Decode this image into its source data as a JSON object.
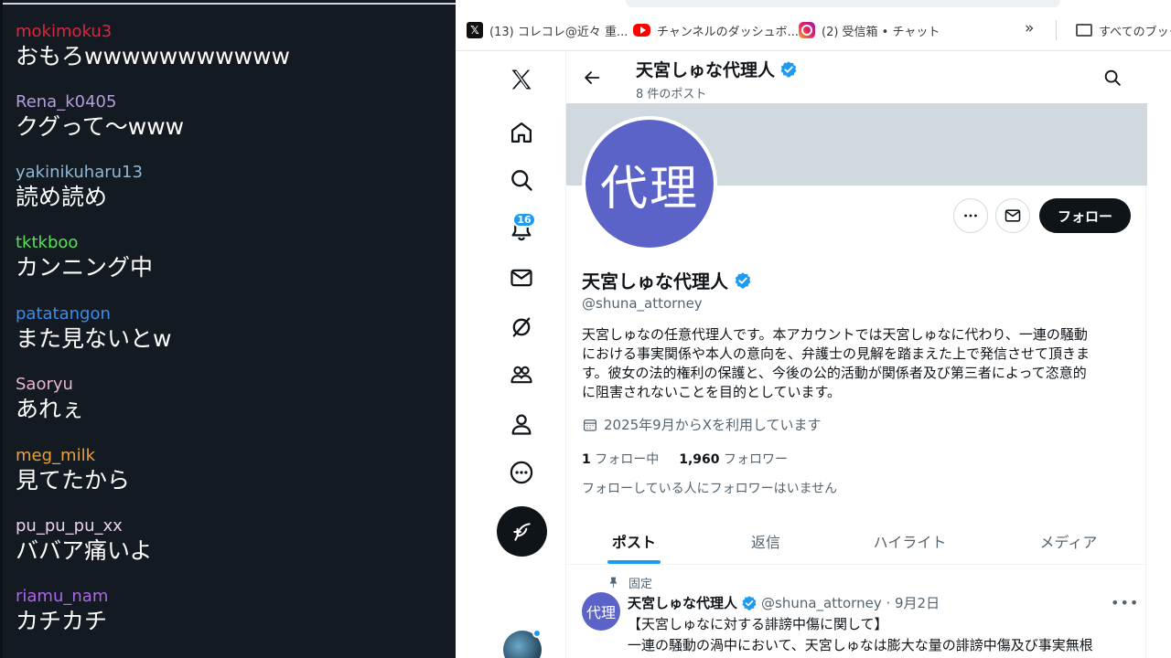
{
  "chat": {
    "messages": [
      {
        "user": "mokimoku3",
        "text": "おもろwwwwwwwwwww",
        "color": "#e0243c"
      },
      {
        "user": "Rena_k0405",
        "text": "クグって～www",
        "color": "#b39ddb"
      },
      {
        "user": "yakinikuharu13",
        "text": "読め読め",
        "color": "#8fb8d8"
      },
      {
        "user": "tktkboo",
        "text": "カンニング中",
        "color": "#58e05a"
      },
      {
        "user": "patatangon",
        "text": "また見ないとw",
        "color": "#3f8be8"
      },
      {
        "user": "Saoryu",
        "text": "あれぇ",
        "color": "#e8b7c9"
      },
      {
        "user": "meg_milk",
        "text": "見てたから",
        "color": "#e8a23a"
      },
      {
        "user": "pu_pu_pu_xx",
        "text": "ババア痛いよ",
        "color": "#ead1f0"
      },
      {
        "user": "riamu_nam",
        "text": "カチカチ",
        "color": "#b066e8"
      }
    ]
  },
  "bookmarks": {
    "items": [
      {
        "label": "(13) コレコレ@近々 重...",
        "icon": "x-icon"
      },
      {
        "label": "チャンネルのダッシュボ...",
        "icon": "youtube-icon"
      },
      {
        "label": "(2) 受信箱 • チャット",
        "icon": "instagram-icon"
      }
    ],
    "overflow": "»",
    "folder_label": "すべてのブック"
  },
  "nav": {
    "notification_count": "16"
  },
  "profile": {
    "header_name": "天宮しゅな代理人",
    "post_count": "8 件のポスト",
    "avatar_text": "代理",
    "name": "天宮しゅな代理人",
    "handle": "@shuna_attorney",
    "bio_lines": [
      "天宮しゅなの任意代理人です。本アカウントでは天宮しゅなに代わり、一連の騒動",
      "における事実関係や本人の意向を、弁護士の見解を踏まえた上で発信させて頂きま",
      "す。彼女の法的権利の保護と、今後の公的活動が関係者及び第三者によって恣意的",
      "に阻害されないことを目的としています。"
    ],
    "joined": "2025年9月からXを利用しています",
    "following_count": "1",
    "following_label": "フォロー中",
    "followers_count": "1,960",
    "followers_label": "フォロワー",
    "no_followers_known": "フォローしている人にフォロワーはいません",
    "follow_button": "フォロー"
  },
  "tabs": [
    "ポスト",
    "返信",
    "ハイライト",
    "メディア"
  ],
  "tweet": {
    "pinned_label": "固定",
    "avatar_text": "代理",
    "name": "天宮しゅな代理人",
    "meta": "@shuna_attorney · 9月2日",
    "lines": [
      "【天宮しゅなに対する誹謗中傷に関して】",
      "一連の騒動の渦中において、天宮しゅなは膨大な量の誹謗中傷及び事実無根"
    ]
  },
  "colors": {
    "accent": "#1d9bf0",
    "avatar_bg": "#5b63c8",
    "chat_bg": "#141a22"
  }
}
